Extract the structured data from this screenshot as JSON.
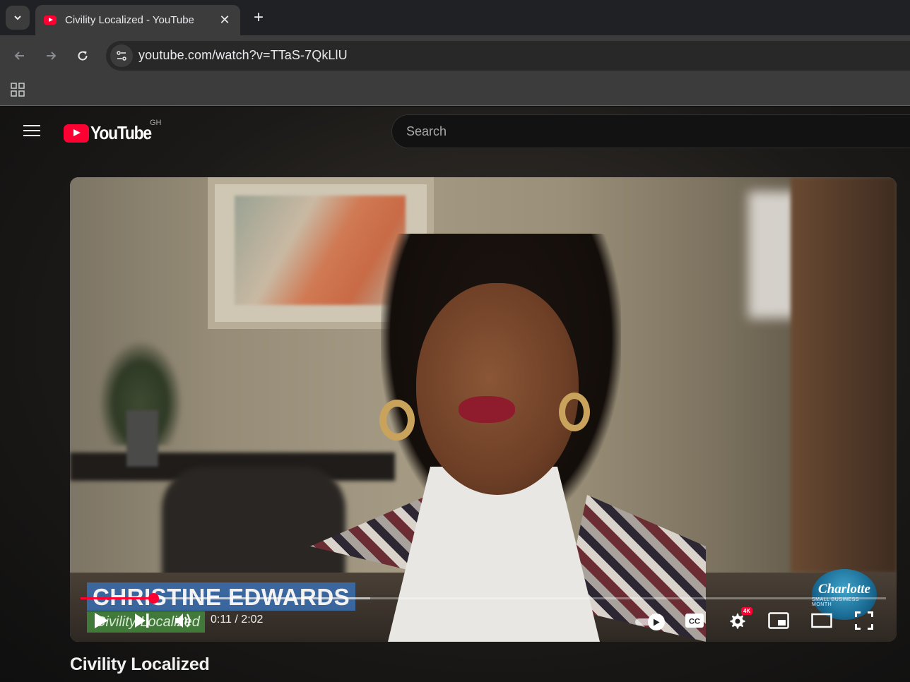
{
  "browser": {
    "tab": {
      "title": "Civility Localized - YouTube",
      "close_label": "✕"
    },
    "new_tab_label": "+",
    "url": "youtube.com/watch?v=TTaS-7QkLlU"
  },
  "youtube": {
    "logo_text": "YouTube",
    "country_code": "GH",
    "search_placeholder": "Search"
  },
  "video": {
    "lower_third_name": "CHRISTINE EDWARDS",
    "lower_third_subtitle": "Civility Localized",
    "badge_text": "Charlotte",
    "badge_subtext": "SMALL BUSINESS MONTH",
    "progress_fraction": 0.0907,
    "loaded_fraction": 0.36,
    "time_display": "0:11 / 2:02",
    "quality_badge": "4K",
    "title": "Civility Localized"
  },
  "colors": {
    "brand_red": "#ff0033",
    "chrome_dark": "#202124",
    "chrome_mid": "#3c3c3c"
  }
}
